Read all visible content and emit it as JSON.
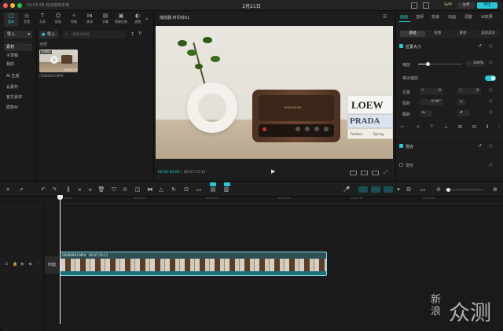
{
  "titlebar": {
    "autosave": "10:56:58 自动保存本地",
    "title": "2月21日",
    "vip": "SVIP",
    "share": "分享",
    "export": "导出"
  },
  "left": {
    "tabs": [
      {
        "label": "素材",
        "icon": "□"
      },
      {
        "label": "音频",
        "icon": "◎"
      },
      {
        "label": "文本",
        "icon": "T"
      },
      {
        "label": "贴纸",
        "icon": "☺"
      },
      {
        "label": "特效",
        "icon": "✧"
      },
      {
        "label": "转场",
        "icon": "⋈"
      },
      {
        "label": "字幕",
        "icon": "▤"
      },
      {
        "label": "智能包装",
        "icon": "▣"
      },
      {
        "label": "滤镜",
        "icon": "◐"
      }
    ],
    "import_dropdown": "导入",
    "import_button": "导入",
    "search_placeholder": "搜索文件名",
    "sort": "↕",
    "filter": "Tr",
    "sidebar": [
      "素材",
      "子草稿",
      "我的",
      "AI 生成",
      "云素材",
      "官方素材",
      "即梦AI"
    ],
    "folder_label": "全部",
    "media": {
      "badge": "已添加",
      "filename": "C0066903.MP4",
      "duration": "00:07:15"
    }
  },
  "player": {
    "title": "播放器-时间线01",
    "current_time": "00:00:00:00",
    "total_time": "00:07:15:11",
    "radio_brand": "HERMOSURA",
    "books": [
      "LOEW",
      "PRADA",
      "Fashion",
      "Spring"
    ]
  },
  "right": {
    "tabs": [
      "画面",
      "音频",
      "变速",
      "动画",
      "调整",
      "AI效果"
    ],
    "subtabs": [
      "基础",
      "抠像",
      "蒙版",
      "美颜美体"
    ],
    "section_position_size": "位置大小",
    "scale_label": "缩放",
    "scale_value": "100%",
    "uniform_scale_label": "等比缩放",
    "position_label": "位置",
    "pos_x": "0",
    "pos_y": "0",
    "rotate_label": "旋转",
    "rotate_value": "0.00°",
    "flip_label": "翻转",
    "blend_label": "混合",
    "transform_label": "变形",
    "align_icons": [
      "⊢",
      "⊣",
      "⊤",
      "⊥",
      "⊞",
      "⊟",
      "⫴",
      "⫶"
    ]
  },
  "timeline": {
    "ruler": [
      "00:00",
      "00:00:20",
      "00:00:40",
      "00:01:00",
      "00:01:20",
      "00:01:40"
    ],
    "clip_name": "C0066903.MP4",
    "clip_duration": "00:07:15:11",
    "cover_label": "封面"
  },
  "watermark": {
    "line1": "新",
    "line2": "浪",
    "big": "众测"
  }
}
